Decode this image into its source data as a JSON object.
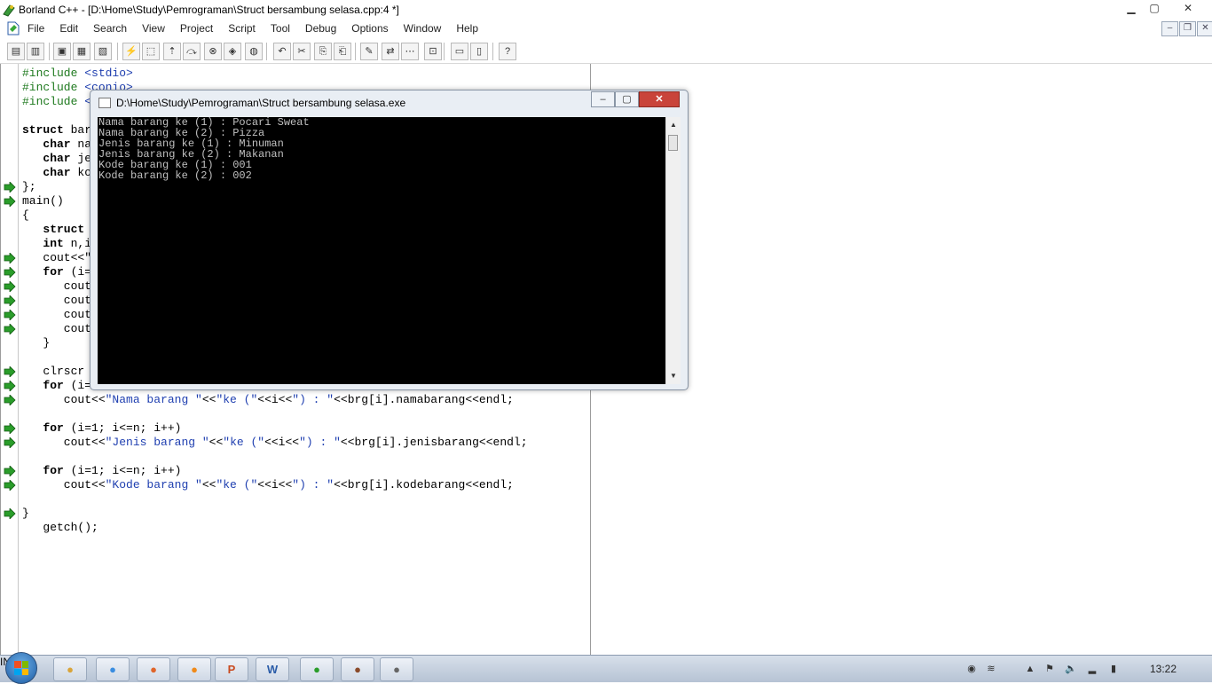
{
  "window": {
    "title": "Borland C++ - [D:\\Home\\Study\\Pemrograman\\Struct bersambung selasa.cpp:4 *]",
    "minimize": "▁",
    "maximize": "▢",
    "close": "✕"
  },
  "menu": [
    "File",
    "Edit",
    "Search",
    "View",
    "Project",
    "Script",
    "Tool",
    "Debug",
    "Options",
    "Window",
    "Help"
  ],
  "mdi_controls": {
    "minimize": "–",
    "restore": "❐",
    "close": "✕"
  },
  "toolbar": {
    "icons": [
      "new-project-icon",
      "open-project-icon",
      "open-file-icon",
      "save-file-icon",
      "save-all-icon",
      "compile-icon",
      "make-icon",
      "run-icon",
      "step-over-icon",
      "stop-icon",
      "breakpoint-icon",
      "watch-icon",
      "undo-icon",
      "cut-icon",
      "copy-icon",
      "paste-icon",
      "search-icon",
      "replace-icon",
      "search-again-icon",
      "browse-icon",
      "window-tile-icon",
      "window-cascade-icon",
      "help-icon"
    ]
  },
  "code_lines": [
    "#include <stdio>",
    "#include <conio>",
    "#include <",
    "",
    "struct bar",
    "   char na",
    "   char je",
    "   char ko",
    "};",
    "main()",
    "{",
    "   struct ",
    "   int n,i",
    "   cout<<\"",
    "   for (i=",
    "      cout",
    "      cout",
    "      cout",
    "      cout",
    "   }",
    "",
    "   clrscr",
    "   for (i=",
    "      cout<<\"Nama barang \"<<\"ke (\"<<i<<\") : \"<<brg[i].namabarang<<endl;",
    "",
    "   for (i=1; i<=n; i++)",
    "      cout<<\"Jenis barang \"<<\"ke (\"<<i<<\") : \"<<brg[i].jenisbarang<<endl;",
    "",
    "   for (i=1; i<=n; i++)",
    "      cout<<\"Kode barang \"<<\"ke (\"<<i<<\") : \"<<brg[i].kodebarang<<endl;",
    "",
    "}",
    "   getch();"
  ],
  "console": {
    "title": "D:\\Home\\Study\\Pemrograman\\Struct bersambung selasa.exe",
    "output": [
      "Nama barang ke (1) : Pocari Sweat",
      "Nama barang ke (2) : Pizza",
      "Jenis barang ke (1) : Minuman",
      "Jenis barang ke (2) : Makanan",
      "Kode barang ke (1) : 001",
      "Kode barang ke (2) : 002"
    ],
    "minimize": "–",
    "maximize": "▢",
    "close": "✕"
  },
  "taskbar": {
    "apps": [
      "explorer-icon",
      "chrome-icon",
      "firefox-icon",
      "media-player-icon",
      "powerpoint-icon",
      "word-icon",
      "borland-icon",
      "tool-icon",
      "console-icon"
    ],
    "app_labels": [
      "",
      "",
      "",
      "",
      "P",
      "W",
      "",
      "",
      ""
    ],
    "language": "IN",
    "clock": "13:22"
  }
}
